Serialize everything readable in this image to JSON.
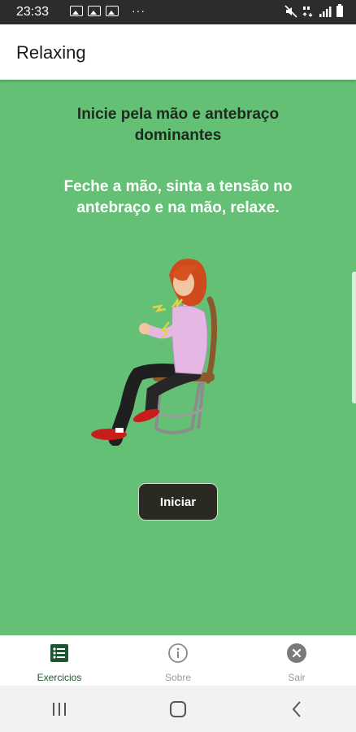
{
  "status_bar": {
    "time": "23:33",
    "more": "···",
    "left_icons": [
      "image-icon",
      "image-icon",
      "image-icon"
    ],
    "right_icons": [
      "mute-icon",
      "4g-icon",
      "signal-icon",
      "battery-icon"
    ]
  },
  "app_bar": {
    "title": "Relaxing"
  },
  "exercise": {
    "heading": "Inicie pela mão e antebraço dominantes",
    "instruction": "Feche a mão, sinta a tensão no antebraço e na mão, relaxe.",
    "illustration": "woman-sitting-on-chair-clenching-hand"
  },
  "start_button": {
    "label": "Iniciar"
  },
  "bottom_nav": {
    "items": [
      {
        "label": "Exercicios",
        "icon": "list-icon",
        "active": true
      },
      {
        "label": "Sobre",
        "icon": "info-icon",
        "active": false
      },
      {
        "label": "Sair",
        "icon": "close-circle-icon",
        "active": false
      }
    ]
  },
  "system_nav": {
    "buttons": [
      "recent-apps-icon",
      "home-icon",
      "back-icon"
    ]
  },
  "colors": {
    "content_background": "#63c074",
    "heading_text": "#1d2b1f",
    "button_background": "#2b2a22",
    "nav_active": "#1e5631",
    "nav_inactive": "#9a9a9a"
  }
}
